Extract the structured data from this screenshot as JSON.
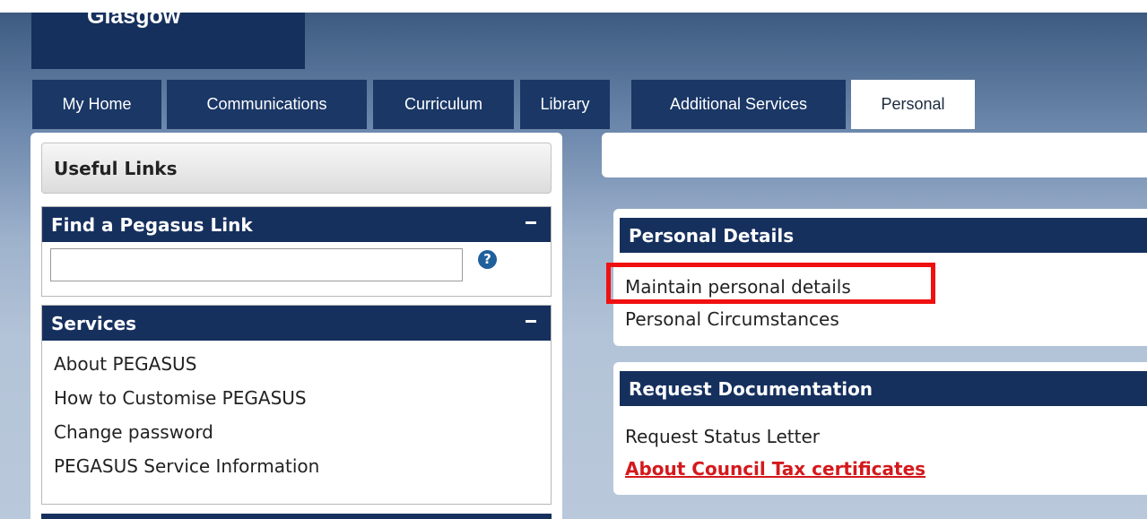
{
  "header": {
    "logo_text": "Glasgow"
  },
  "tabs": [
    {
      "label": "My Home"
    },
    {
      "label": "Communications"
    },
    {
      "label": "Curriculum"
    },
    {
      "label": "Library"
    },
    {
      "label": "Additional Services"
    },
    {
      "label": "Personal",
      "active": true
    }
  ],
  "sidebar": {
    "useful_links_title": "Useful Links",
    "find_link": {
      "title": "Find a Pegasus Link",
      "input_value": "",
      "help_icon": "?"
    },
    "services": {
      "title": "Services",
      "items": [
        {
          "label": "About PEGASUS"
        },
        {
          "label": "How to Customise PEGASUS"
        },
        {
          "label": "Change password"
        },
        {
          "label": "PEGASUS Service Information"
        }
      ]
    }
  },
  "main": {
    "personal_details": {
      "title": "Personal Details",
      "items": [
        {
          "label": "Maintain personal details"
        },
        {
          "label": "Personal Circumstances"
        }
      ]
    },
    "request_documentation": {
      "title": "Request Documentation",
      "items": [
        {
          "label": "Request Status Letter"
        },
        {
          "label": "About Council Tax certificates"
        }
      ]
    }
  },
  "colors": {
    "nav_dark": "#16305e",
    "highlight": "#f01010",
    "alert_link": "#d4191c"
  }
}
